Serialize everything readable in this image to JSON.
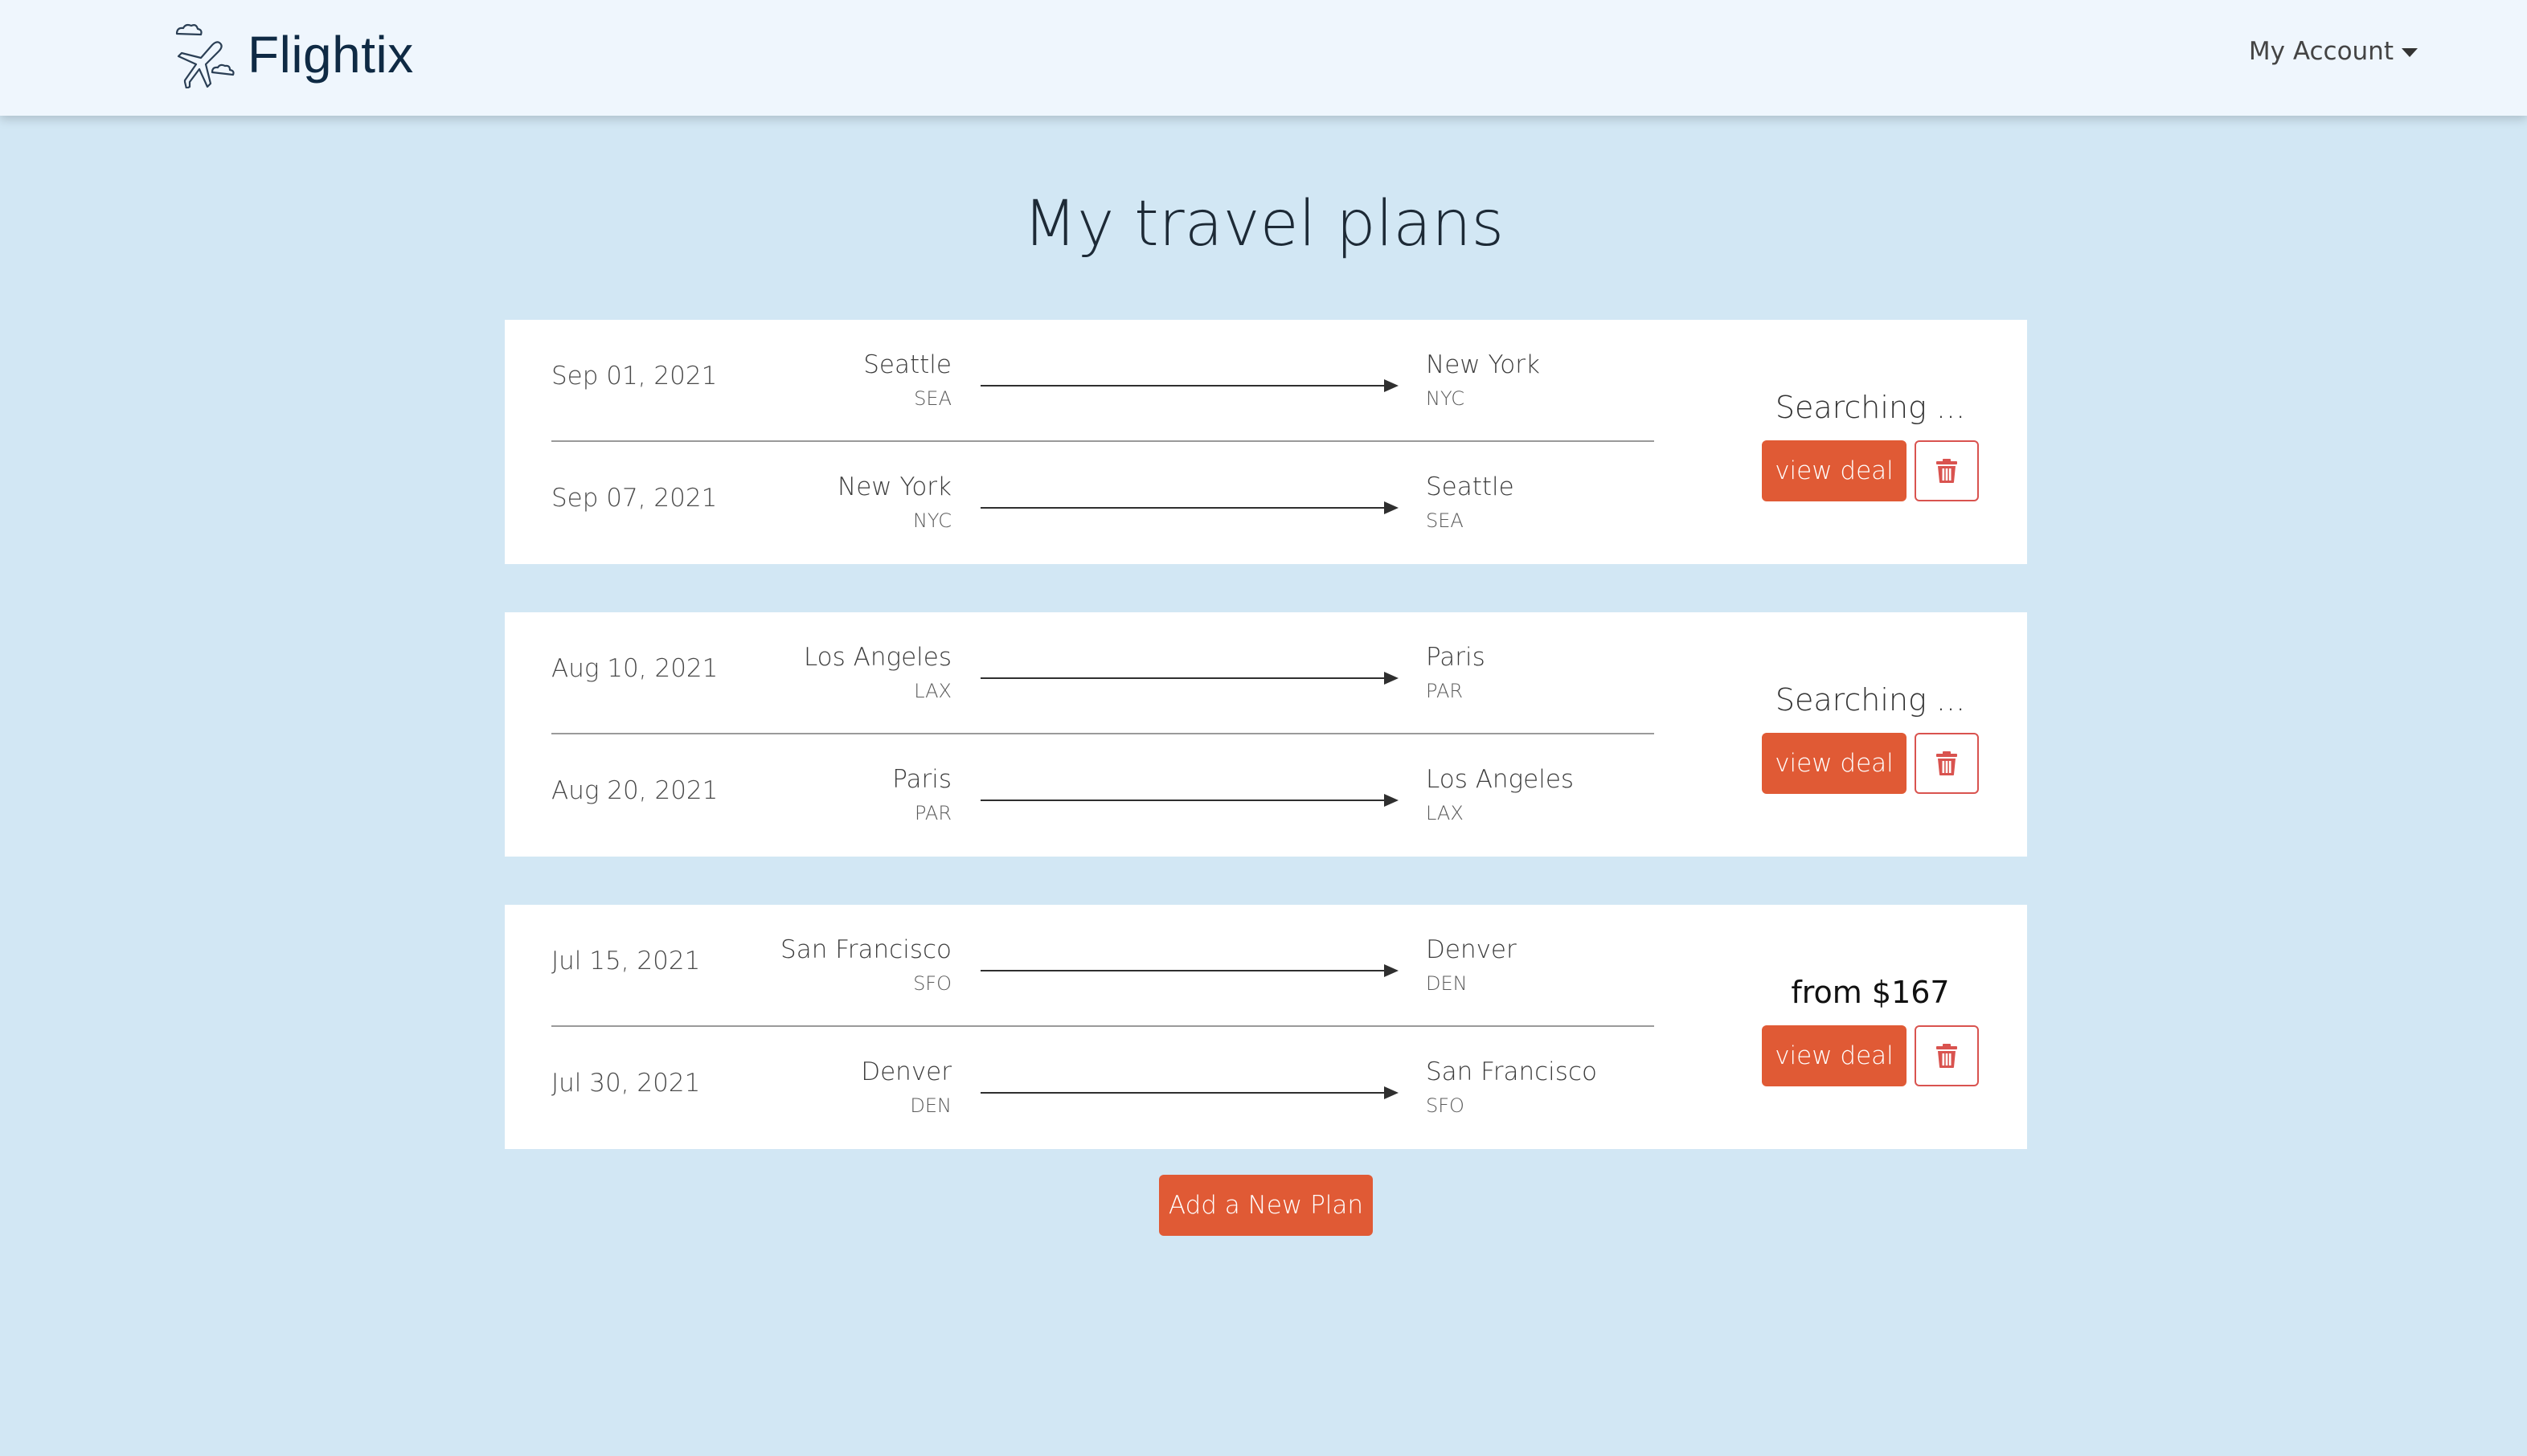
{
  "navbar": {
    "brand": "Flightix",
    "logo_icon": "plane-cloud-logo-icon",
    "account_label": "My Account"
  },
  "page": {
    "title": "My travel plans"
  },
  "plans": [
    {
      "status": "Searching ...",
      "view_label": "view deal",
      "legs": [
        {
          "date": "Sep 01, 2021",
          "from_city": "Seattle",
          "from_code": "SEA",
          "to_city": "New York",
          "to_code": "NYC"
        },
        {
          "date": "Sep 07, 2021",
          "from_city": "New York",
          "from_code": "NYC",
          "to_city": "Seattle",
          "to_code": "SEA"
        }
      ]
    },
    {
      "status": "Searching ...",
      "view_label": "view deal",
      "legs": [
        {
          "date": "Aug 10, 2021",
          "from_city": "Los Angeles",
          "from_code": "LAX",
          "to_city": "Paris",
          "to_code": "PAR"
        },
        {
          "date": "Aug 20, 2021",
          "from_city": "Paris",
          "from_code": "PAR",
          "to_city": "Los Angeles",
          "to_code": "LAX"
        }
      ]
    },
    {
      "status": "from $167",
      "view_label": "view deal",
      "legs": [
        {
          "date": "Jul 15, 2021",
          "from_city": "San Francisco",
          "from_code": "SFO",
          "to_city": "Denver",
          "to_code": "DEN"
        },
        {
          "date": "Jul 30, 2021",
          "from_city": "Denver",
          "from_code": "DEN",
          "to_city": "San Francisco",
          "to_code": "SFO"
        }
      ]
    }
  ],
  "add_plan_label": "Add a New Plan",
  "colors": {
    "accent": "#e05a35",
    "danger": "#d9534f",
    "background": "#d2e7f4",
    "navbar": "#eff6fd"
  }
}
